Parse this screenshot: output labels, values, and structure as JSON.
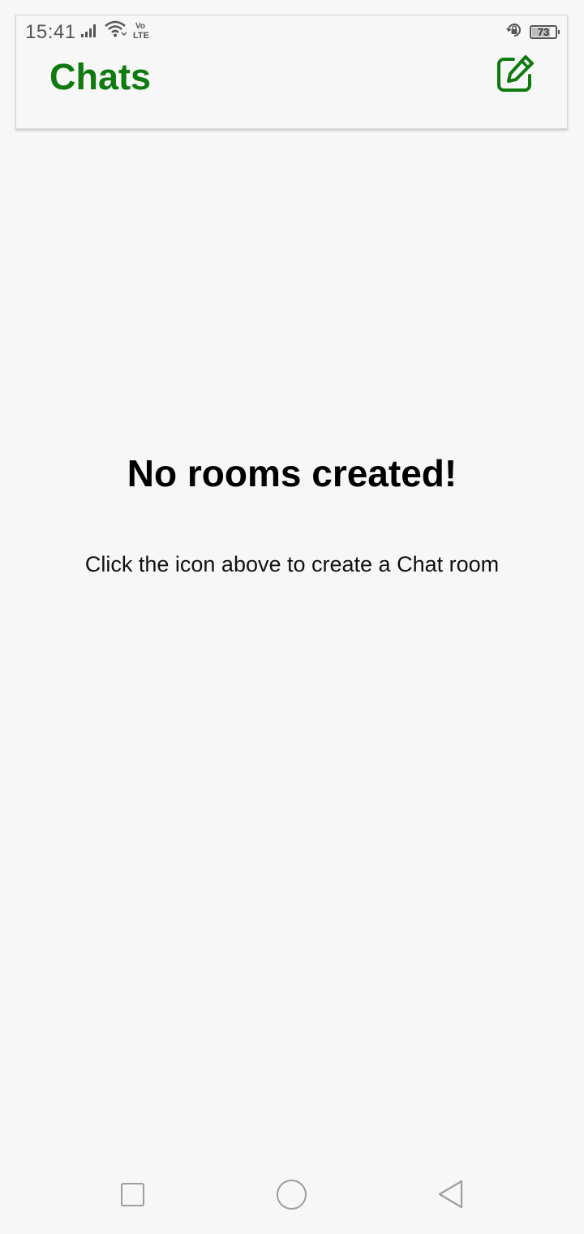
{
  "status_bar": {
    "time": "15:41",
    "network_label": "Vo\nLTE",
    "battery_level": "73",
    "icons": [
      "signal-icon",
      "wifi-icon",
      "volte-icon",
      "rotation-lock-icon",
      "battery-icon"
    ]
  },
  "app_bar": {
    "title": "Chats",
    "action_icon": "compose-icon"
  },
  "empty_state": {
    "title": "No rooms created!",
    "subtitle": "Click the icon above to create a Chat room"
  },
  "nav_bar": {
    "icons": [
      "recents-icon",
      "home-icon",
      "back-icon"
    ]
  },
  "colors": {
    "accent": "#0f7b0f",
    "background": "#f7f7f7"
  }
}
